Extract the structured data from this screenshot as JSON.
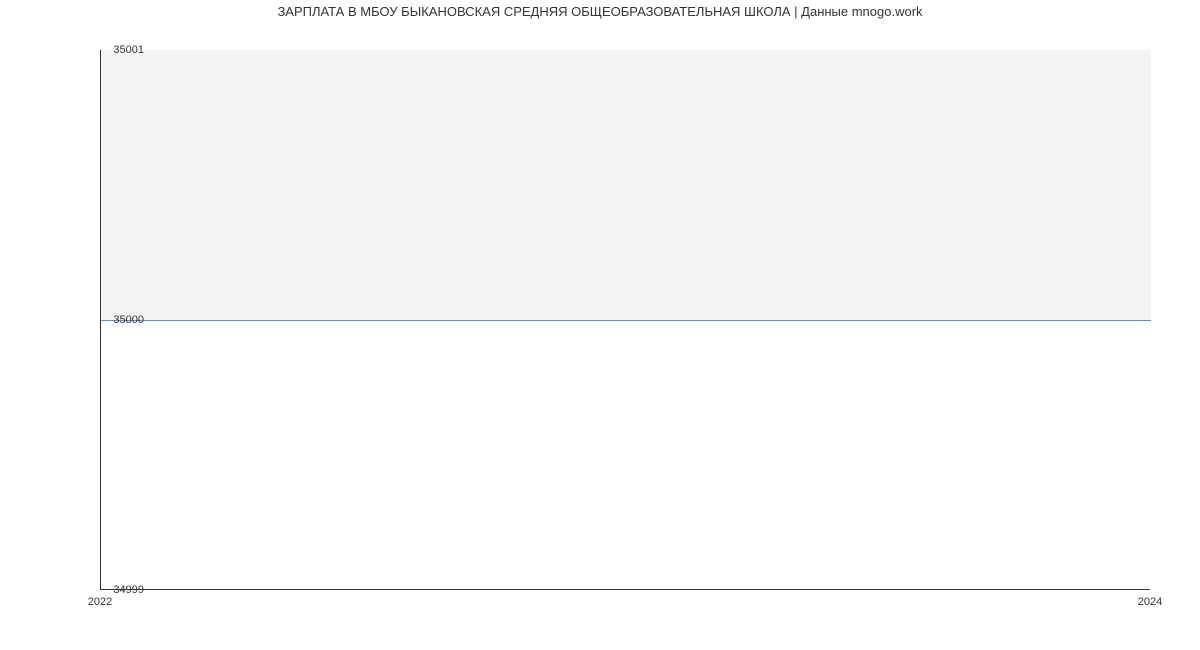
{
  "chart_data": {
    "type": "area",
    "title": "ЗАРПЛАТА В МБОУ БЫКАНОВСКАЯ СРЕДНЯЯ ОБЩЕОБРАЗОВАТЕЛЬНАЯ ШКОЛА | Данные mnogo.work",
    "x": [
      2022,
      2024
    ],
    "values": [
      35000,
      35000
    ],
    "x_ticks": [
      "2022",
      "2024"
    ],
    "y_ticks": [
      "34999",
      "35000",
      "35001"
    ],
    "xlim": [
      2022,
      2024
    ],
    "ylim": [
      34999,
      35001
    ],
    "xlabel": "",
    "ylabel": "",
    "line_color": "#5b8fd6",
    "fill_color": "#f3f3f3"
  }
}
